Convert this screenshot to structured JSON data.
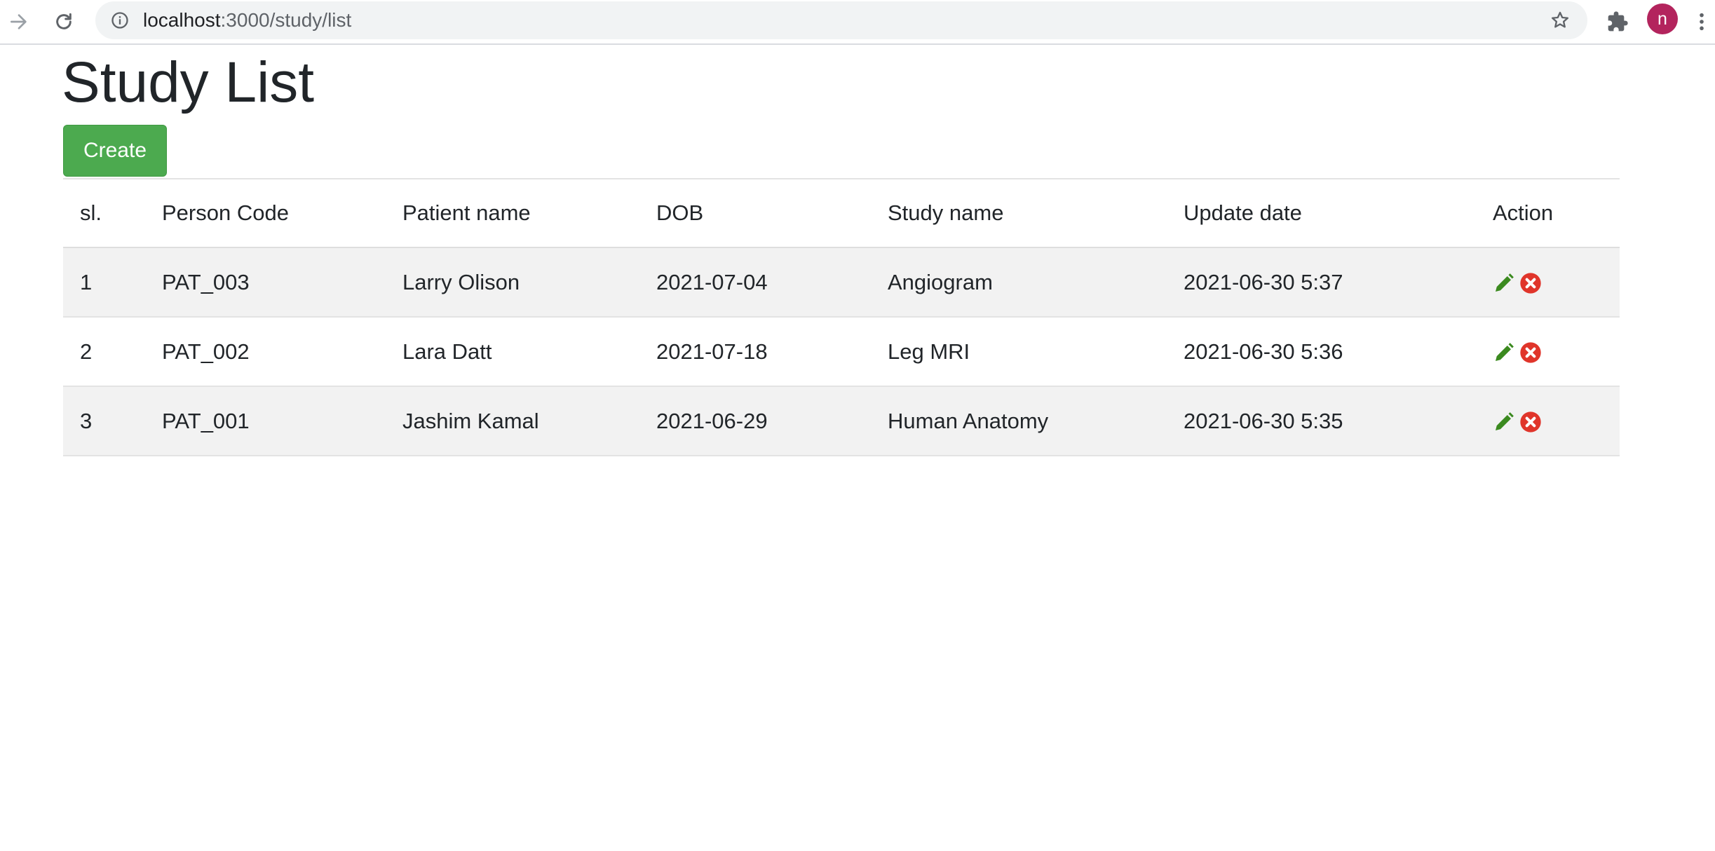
{
  "browser": {
    "url_host": "localhost",
    "url_path": ":3000/study/list",
    "profile_initial": "n"
  },
  "page": {
    "title": "Study List",
    "create_label": "Create"
  },
  "table": {
    "headers": [
      "sl.",
      "Person Code",
      "Patient name",
      "DOB",
      "Study name",
      "Update date",
      "Action"
    ],
    "rows": [
      {
        "sl": "1",
        "person_code": "PAT_003",
        "patient_name": "Larry Olison",
        "dob": "2021-07-04",
        "study_name": "Angiogram",
        "update_date": "2021-06-30 5:37"
      },
      {
        "sl": "2",
        "person_code": "PAT_002",
        "patient_name": "Lara Datt",
        "dob": "2021-07-18",
        "study_name": "Leg MRI",
        "update_date": "2021-06-30 5:36"
      },
      {
        "sl": "3",
        "person_code": "PAT_001",
        "patient_name": "Jashim Kamal",
        "dob": "2021-06-29",
        "study_name": "Human Anatomy",
        "update_date": "2021-06-30 5:35"
      }
    ],
    "action_icons": [
      "pencil-icon",
      "delete-circle-icon"
    ]
  },
  "colors": {
    "create_button": "#4caa4f",
    "edit_icon": "#3b8a1f",
    "delete_icon": "#e0352b",
    "striped_row": "#f2f2f2",
    "avatar": "#b3245d"
  }
}
